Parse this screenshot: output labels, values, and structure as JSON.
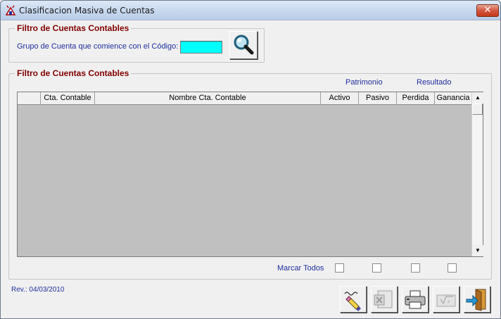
{
  "window": {
    "title": "Clasificacion Masiva de Cuentas",
    "close_label": "✕"
  },
  "filter_top": {
    "title": "Filtro de Cuentas Contables",
    "code_label": "Grupo de Cuenta que comience con el Código:",
    "code_value": "",
    "search_icon": "magnifier-icon"
  },
  "filter_main": {
    "title": "Filtro de Cuentas Contables",
    "group_patrimonio": "Patrimonio",
    "group_resultado": "Resultado"
  },
  "grid": {
    "columns": [
      "",
      "Cta. Contable",
      "Nombre Cta. Contable",
      "Activo",
      "Pasivo",
      "Perdida",
      "Ganancia"
    ],
    "rows": []
  },
  "mark_all_label": "Marcar Todos",
  "revision": "Rev.: 04/03/2010",
  "toolbar": {
    "icons": [
      "clear-eraser-icon",
      "export-excel-icon",
      "printer-icon",
      "calculator-icon",
      "exit-door-icon"
    ]
  },
  "colors": {
    "input_background": "#00ffff",
    "group_title": "#800000",
    "label_blue": "#1f2f9c",
    "grid_background": "#c0c0c0"
  }
}
